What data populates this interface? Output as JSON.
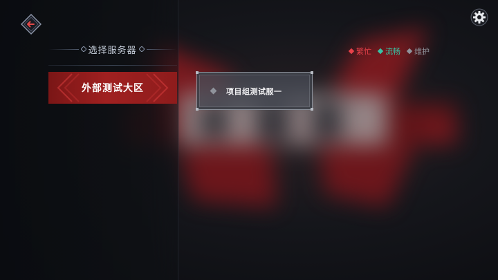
{
  "header": {
    "back_icon": "back-arrow-icon",
    "settings_icon": "gear-icon"
  },
  "panel": {
    "title": "选择服务器"
  },
  "regions": [
    {
      "label": "外部测试大区",
      "selected": true
    }
  ],
  "legend": [
    {
      "label": "繁忙",
      "color": "#e8414a"
    },
    {
      "label": "流畅",
      "color": "#37c4a6"
    },
    {
      "label": "维护",
      "color": "#8f939b"
    }
  ],
  "servers": [
    {
      "name": "项目组测试服一",
      "status": "维护",
      "status_color": "#8f939b"
    }
  ],
  "colors": {
    "accent_red": "#a02020",
    "background": "#0d0f13"
  }
}
